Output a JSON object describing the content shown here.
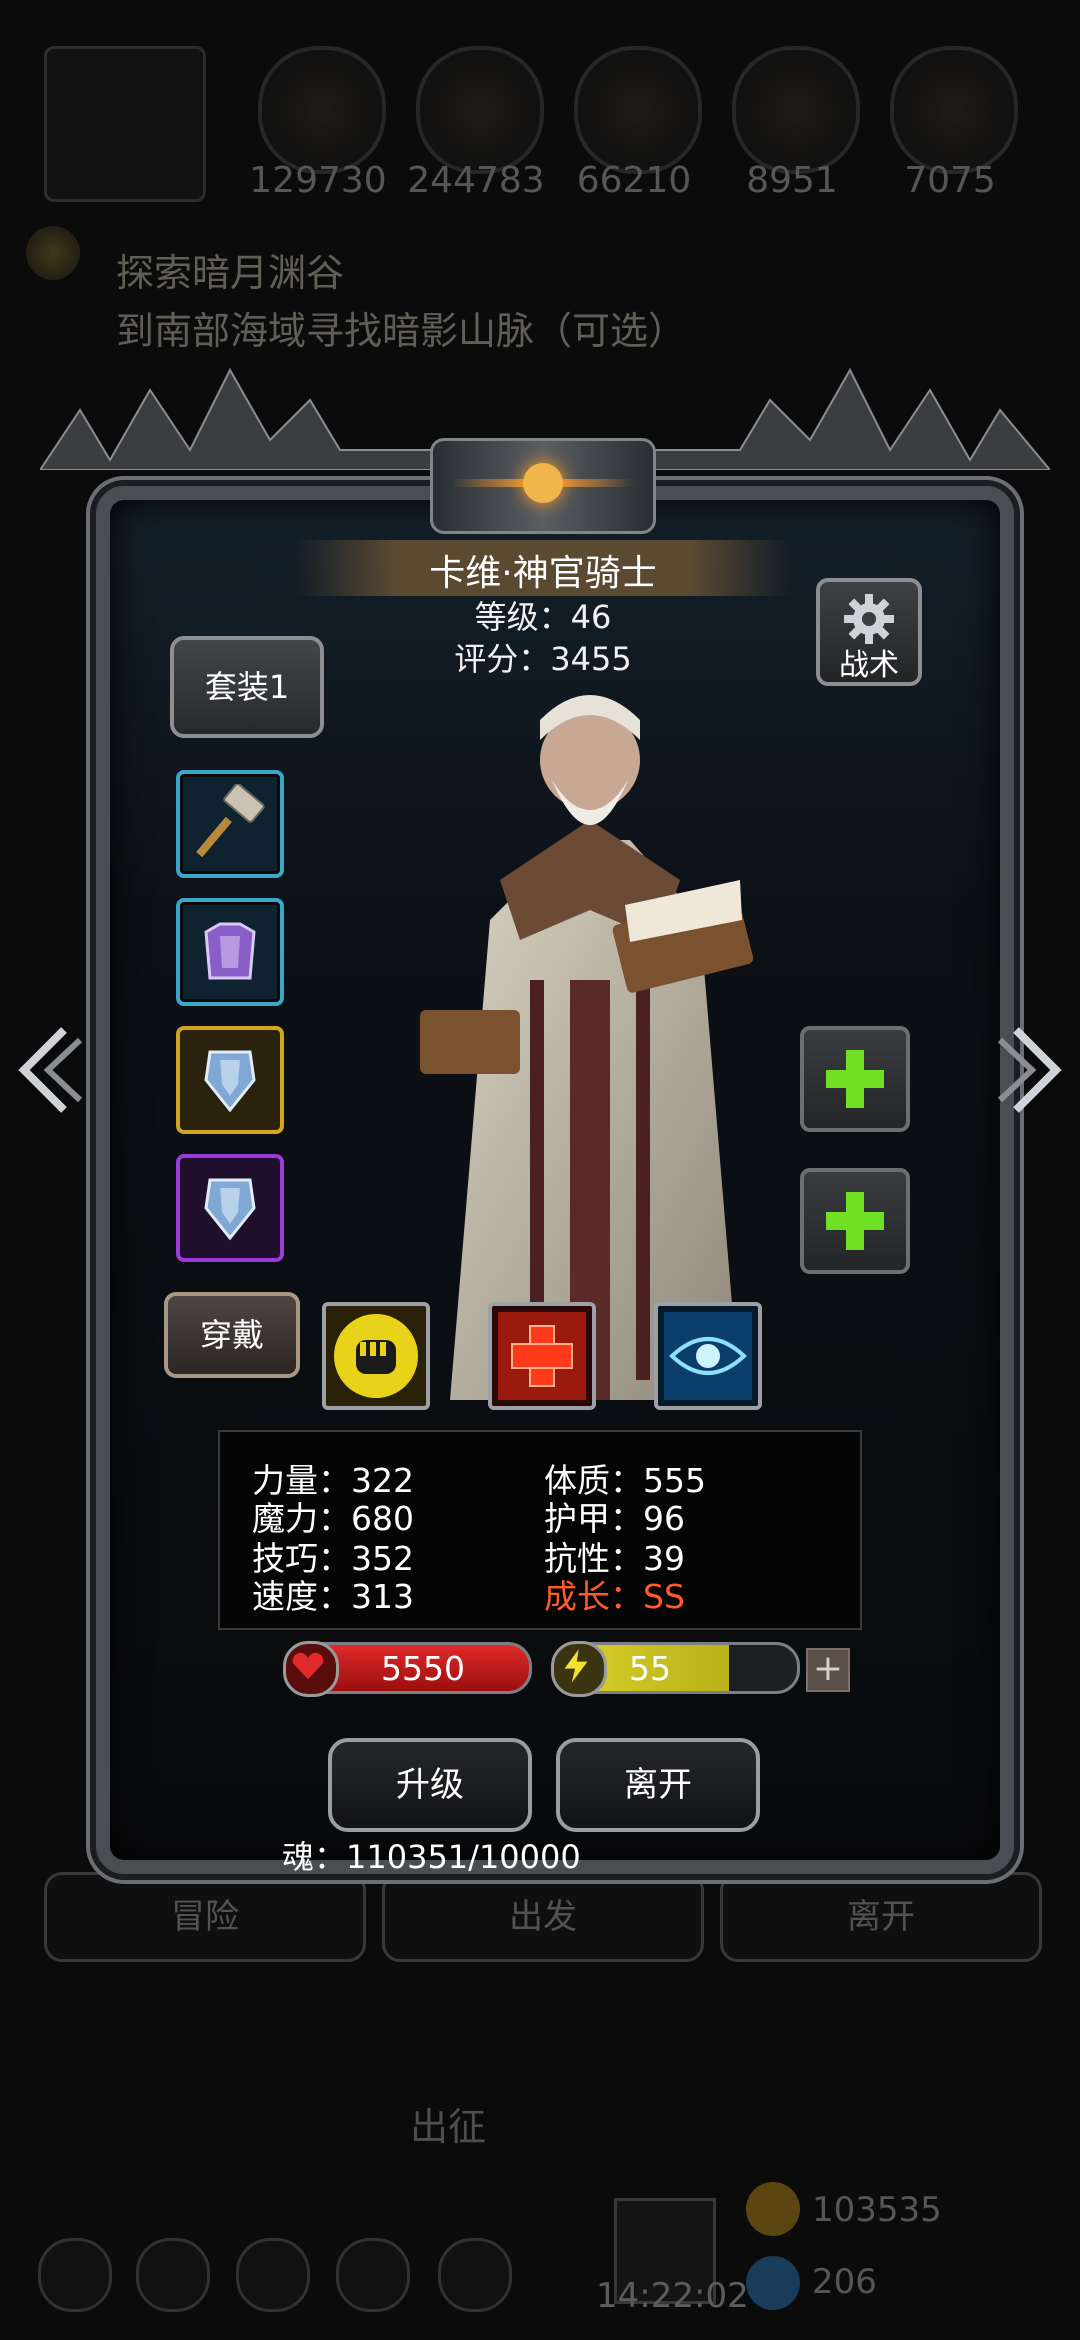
{
  "background": {
    "resources": [
      "129730",
      "244783",
      "66210",
      "8951",
      "7075"
    ],
    "quest": {
      "title": "探索暗月渊谷",
      "subtitle": "到南部海域寻找暗影山脉（可选）"
    },
    "bottom_tabs": [
      "冒险",
      "出发",
      "离开"
    ],
    "set_out_label": "出征",
    "gold": "103535",
    "gems": "206",
    "clock": "14:22:02"
  },
  "hero": {
    "name": "卡维·神官骑士",
    "level_text": "等级：46",
    "score_text": "评分：3455"
  },
  "buttons": {
    "set_label": "套装1",
    "tactics_label": "战术",
    "wear_label": "穿戴",
    "upgrade_label": "升级",
    "leave_label": "离开",
    "energy_plus": "+"
  },
  "equipment_icons": [
    "hammer-icon",
    "armor-icon",
    "shield-gold-icon",
    "shield-purple-icon"
  ],
  "skill_icons": [
    "fist-icon",
    "cross-icon",
    "eye-icon"
  ],
  "stats": {
    "strength": "力量：322",
    "magic": "魔力：680",
    "skill": "技巧：352",
    "speed": "速度：313",
    "constitution": "体质：555",
    "armor": "护甲：96",
    "resistance": "抗性：39",
    "growth": "成长：SS"
  },
  "hp": "5550",
  "energy": "55",
  "energy_fill_fraction": 0.72,
  "soul_text": "魂：110351/10000",
  "colors": {
    "accent_green": "#6fe024",
    "growth_red": "#ff5a2a",
    "hp_red": "#e22a2a",
    "energy_yellow": "#d9d12a"
  }
}
